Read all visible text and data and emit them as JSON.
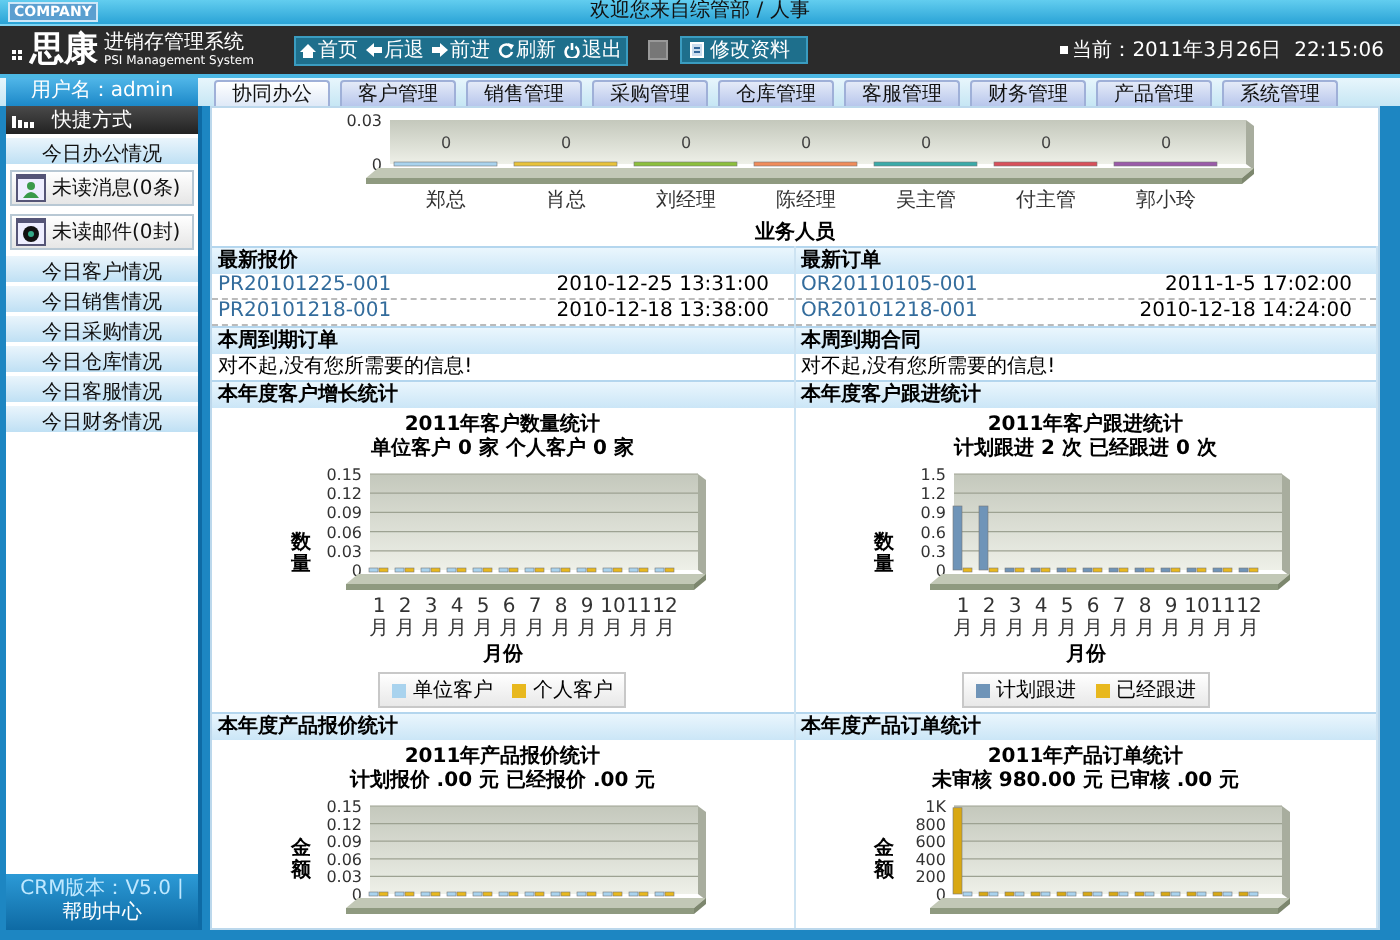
{
  "header": {
    "badge": "COMPANY",
    "welcome": "欢迎您来自综管部 / 人事",
    "logo": "思康",
    "system_name": "进销存管理系统",
    "system_name_en": "PSI Management System",
    "nav": [
      {
        "kind": "home",
        "label": "首页"
      },
      {
        "kind": "back",
        "label": "后退"
      },
      {
        "kind": "forward",
        "label": "前进"
      },
      {
        "kind": "refresh",
        "label": "刷新"
      },
      {
        "kind": "logout",
        "label": "退出"
      }
    ],
    "edit_profile": "修改资料",
    "clock": "当前：2011年3月26日  22:15:06"
  },
  "user": "用户名：admin",
  "tabs": [
    {
      "label": "协同办公",
      "selected": true
    },
    {
      "label": "客户管理",
      "selected": false
    },
    {
      "label": "销售管理",
      "selected": false
    },
    {
      "label": "采购管理",
      "selected": false
    },
    {
      "label": "仓库管理",
      "selected": false
    },
    {
      "label": "客服管理",
      "selected": false
    },
    {
      "label": "财务管理",
      "selected": false
    },
    {
      "label": "产品管理",
      "selected": false
    },
    {
      "label": "系统管理",
      "selected": false
    }
  ],
  "sidebar": {
    "title": "快捷方式",
    "items": [
      {
        "kind": "bar",
        "label": "今日办公情况"
      },
      {
        "kind": "message",
        "label": "未读消息(0条)"
      },
      {
        "kind": "mail",
        "label": "未读邮件(0封)"
      },
      {
        "kind": "bar",
        "label": "今日客户情况"
      },
      {
        "kind": "bar",
        "label": "今日销售情况"
      },
      {
        "kind": "bar",
        "label": "今日采购情况"
      },
      {
        "kind": "bar",
        "label": "今日仓库情况"
      },
      {
        "kind": "bar",
        "label": "今日客服情况"
      },
      {
        "kind": "bar",
        "label": "今日财务情况"
      }
    ],
    "version": "CRM版本：V5.0",
    "separator": "|",
    "help": "帮助中心"
  },
  "staff_chart": {
    "bars": [
      {
        "color": "#a9d3ee"
      },
      {
        "color": "#e8c23a"
      },
      {
        "color": "#8cbf3c"
      },
      {
        "color": "#f08c5a"
      },
      {
        "color": "#3aaaa8"
      },
      {
        "color": "#d8505a"
      },
      {
        "color": "#9a5aa8"
      }
    ],
    "chart_data": {
      "type": "bar",
      "xlabel": "业务人员",
      "categories": [
        "郑总",
        "肖总",
        "刘经理",
        "陈经理",
        "吴主管",
        "付主管",
        "郭小玲"
      ],
      "values": [
        0,
        0,
        0,
        0,
        0,
        0,
        0
      ],
      "ylim": [
        0,
        0.03
      ],
      "yticks": [
        0,
        0.03
      ],
      "data_labels": true
    }
  },
  "quotes": {
    "title": "最新报价",
    "rows": [
      {
        "code": "PR20101225-001",
        "time": "2010-12-25 13:31:00"
      },
      {
        "code": "PR20101218-001",
        "time": "2010-12-18 13:38:00"
      }
    ]
  },
  "orders": {
    "title": "最新订单",
    "rows": [
      {
        "code": "OR20110105-001",
        "time": "2011-1-5 17:02:00"
      },
      {
        "code": "OR20101218-001",
        "time": "2010-12-18 14:24:00"
      }
    ]
  },
  "due_orders": {
    "title": "本周到期订单",
    "message": "对不起,没有您所需要的信息!"
  },
  "due_contracts": {
    "title": "本周到期合同",
    "message": "对不起,没有您所需要的信息!"
  },
  "panels": [
    {
      "title": "本年度客户增长统计",
      "subtitle": "单位客户 0 家 个人客户 0 家",
      "chart_data": {
        "type": "bar",
        "title": "2011年客户数量统计",
        "xlabel": "月份",
        "ylabel": "数量",
        "categories": [
          "1月",
          "2月",
          "3月",
          "4月",
          "5月",
          "6月",
          "7月",
          "8月",
          "9月",
          "10月",
          "11月",
          "12月"
        ],
        "ylim": [
          0,
          0.15
        ],
        "yticks": [
          0,
          0.03,
          0.06,
          0.09,
          0.12,
          0.15
        ],
        "grid": true,
        "series": [
          {
            "name": "单位客户",
            "color": "#a9d3ee",
            "values": [
              0,
              0,
              0,
              0,
              0,
              0,
              0,
              0,
              0,
              0,
              0,
              0
            ]
          },
          {
            "name": "个人客户",
            "color": "#e8b81e",
            "values": [
              0,
              0,
              0,
              0,
              0,
              0,
              0,
              0,
              0,
              0,
              0,
              0
            ]
          }
        ]
      }
    },
    {
      "title": "本年度客户跟进统计",
      "subtitle": "计划跟进 2 次 已经跟进 0 次",
      "chart_data": {
        "type": "bar",
        "title": "2011年客户跟进统计",
        "xlabel": "月份",
        "ylabel": "数量",
        "categories": [
          "1月",
          "2月",
          "3月",
          "4月",
          "5月",
          "6月",
          "7月",
          "8月",
          "9月",
          "10月",
          "11月",
          "12月"
        ],
        "ylim": [
          0,
          1.5
        ],
        "yticks": [
          0,
          0.3,
          0.6,
          0.9,
          1.2,
          1.5
        ],
        "grid": true,
        "series": [
          {
            "name": "计划跟进",
            "color": "#6f94b8",
            "values": [
              1,
              1,
              0,
              0,
              0,
              0,
              0,
              0,
              0,
              0,
              0,
              0
            ]
          },
          {
            "name": "已经跟进",
            "color": "#e8b81e",
            "values": [
              0,
              0,
              0,
              0,
              0,
              0,
              0,
              0,
              0,
              0,
              0,
              0
            ]
          }
        ]
      }
    },
    {
      "title": "本年度产品报价统计",
      "subtitle": "计划报价 .00 元 已经报价 .00 元",
      "chart_data": {
        "type": "bar",
        "title": "2011年产品报价统计",
        "ylabel": "金额",
        "ylim": [
          0,
          0.15
        ],
        "yticks": [
          0,
          0.03,
          0.06,
          0.09,
          0.12,
          0.15
        ],
        "grid": true,
        "series": [
          {
            "color": "#a9d3ee",
            "values": [
              0,
              0,
              0,
              0,
              0,
              0,
              0,
              0,
              0,
              0,
              0,
              0
            ]
          },
          {
            "color": "#e8b81e",
            "values": [
              0,
              0,
              0,
              0,
              0,
              0,
              0,
              0,
              0,
              0,
              0,
              0
            ]
          }
        ]
      }
    },
    {
      "title": "本年度产品订单统计",
      "subtitle": "未审核 980.00 元 已审核 .00 元",
      "chart_data": {
        "type": "bar",
        "title": "2011年产品订单统计",
        "ylabel": "金额",
        "ylim": [
          0,
          1000
        ],
        "yticks": [
          0,
          200,
          400,
          600,
          800,
          {
            "value": 1000,
            "label": "1K"
          }
        ],
        "grid": true,
        "series": [
          {
            "color": "#d8a814",
            "values": [
              980,
              0,
              0,
              0,
              0,
              0,
              0,
              0,
              0,
              0,
              0,
              0
            ]
          },
          {
            "color": "#a9d3ee",
            "values": [
              0,
              0,
              0,
              0,
              0,
              0,
              0,
              0,
              0,
              0,
              0,
              0
            ]
          }
        ]
      }
    }
  ]
}
